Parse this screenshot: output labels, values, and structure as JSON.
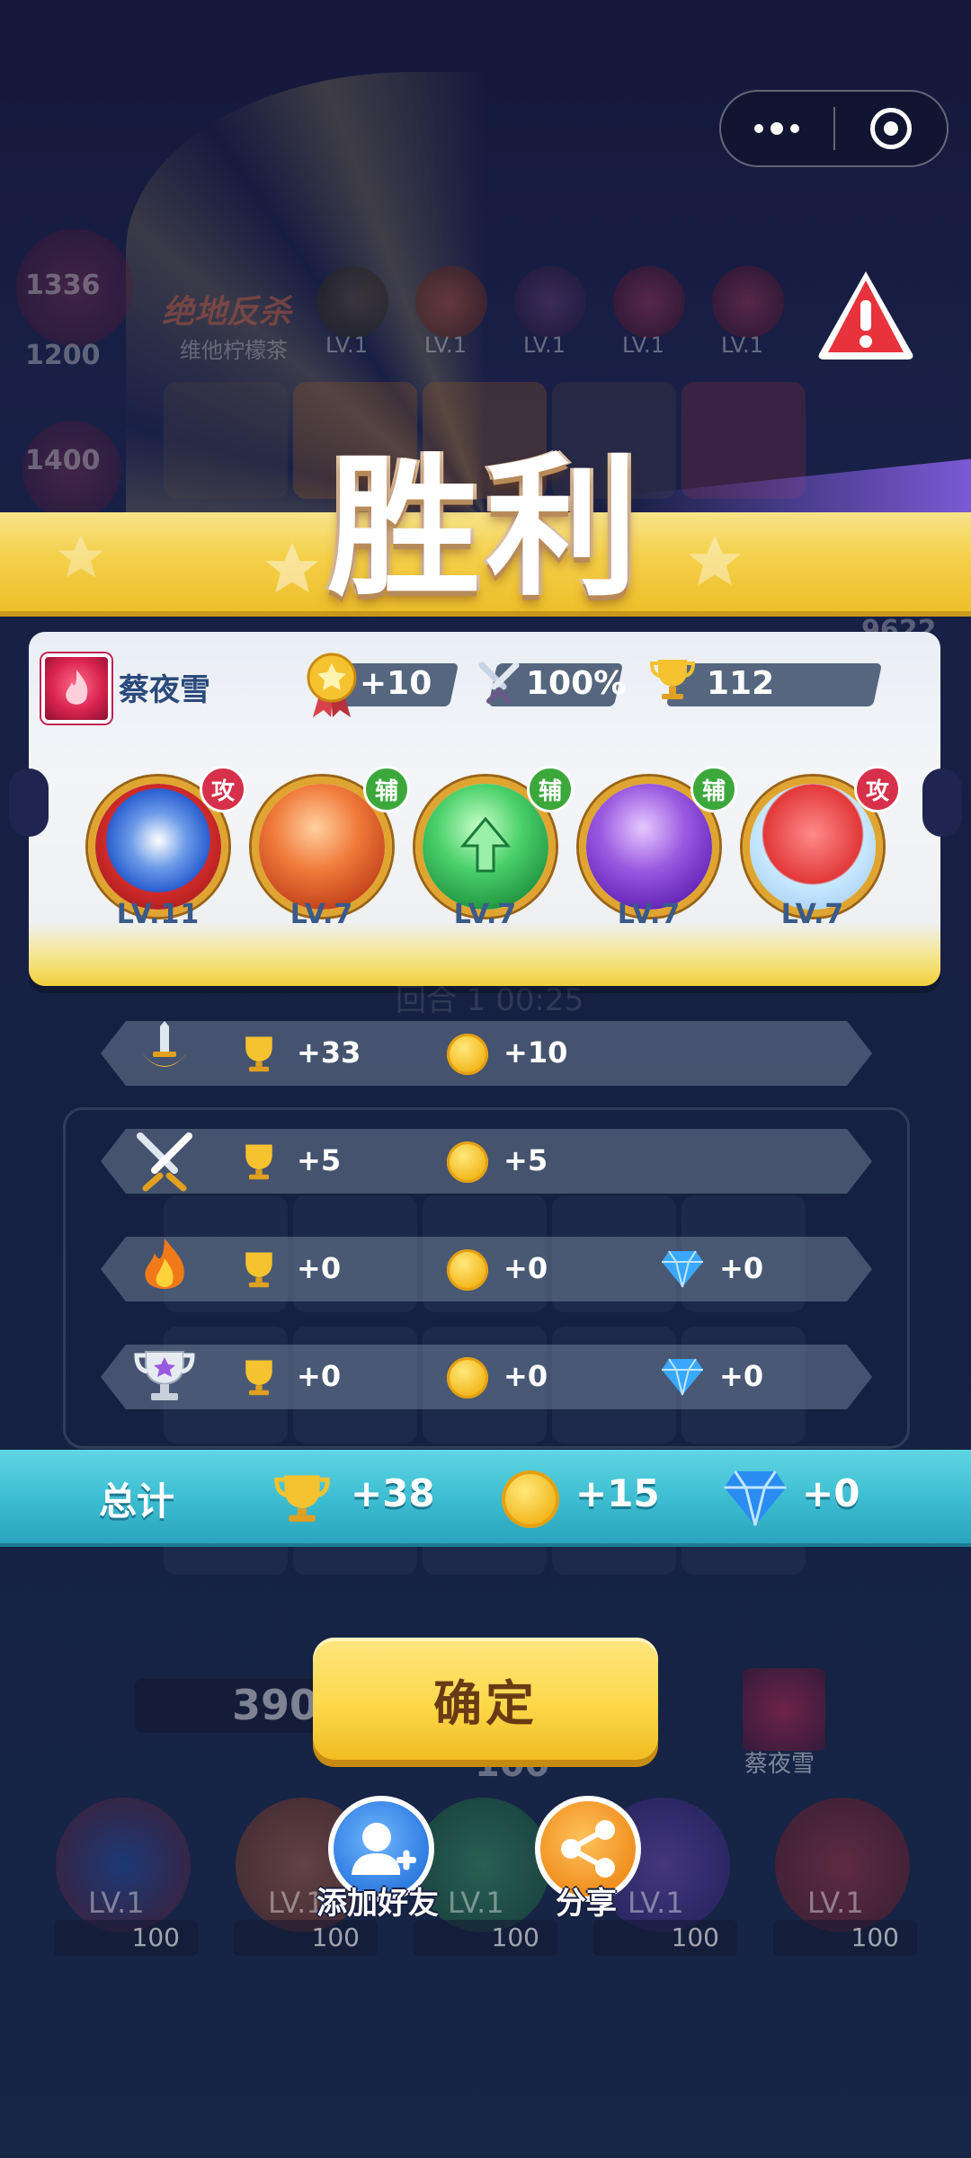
{
  "capsule": {
    "more_icon": "more-dots-icon",
    "close_icon": "target-icon"
  },
  "background": {
    "event_label": "绝地反杀",
    "event_sub": "维他柠檬茶",
    "top_levels": [
      "LV.1",
      "LV.1",
      "LV.1",
      "LV.1",
      "LV.1"
    ],
    "scores": [
      "1336",
      "1200",
      "1400"
    ],
    "right_score": "9622",
    "round_timer": "回合 1 00:25",
    "sp_value": "390",
    "sp_sub": "100",
    "opponent_name": "蔡夜雪",
    "bottom_levels": [
      "LV.1",
      "LV.1",
      "LV.1",
      "LV.1",
      "LV.1"
    ],
    "bottom_sp": [
      "100",
      "100",
      "100",
      "100",
      "100"
    ]
  },
  "victory": {
    "title": "胜利"
  },
  "player": {
    "name": "蔡夜雪",
    "medal_bonus": "+10",
    "win_rate": "100%",
    "trophies": "112"
  },
  "heroes": [
    {
      "level": "LV.11",
      "role": "攻",
      "icon": "opera-mask-icon",
      "color": "#2a5fd0"
    },
    {
      "level": "LV.7",
      "role": "辅",
      "icon": "phoenix-orb-icon",
      "color": "#e0602a"
    },
    {
      "level": "LV.7",
      "role": "辅",
      "icon": "arrow-star-orb-icon",
      "color": "#2fae4a"
    },
    {
      "level": "LV.7",
      "role": "辅",
      "icon": "purple-leaf-orb-icon",
      "color": "#7a3ad0"
    },
    {
      "level": "LV.7",
      "role": "攻",
      "icon": "red-blob-icon",
      "color": "#e23838"
    }
  ],
  "rewards": [
    {
      "icon": "sword-shield-icon",
      "trophy": "+33",
      "coin": "+10"
    },
    {
      "icon": "crossed-swords-icon",
      "trophy": "+5",
      "coin": "+5"
    },
    {
      "icon": "fire-icon",
      "trophy": "+0",
      "coin": "+0",
      "gem": "+0"
    },
    {
      "icon": "silver-cup-icon",
      "trophy": "+0",
      "coin": "+0",
      "gem": "+0"
    }
  ],
  "total": {
    "label": "总计",
    "trophy": "+38",
    "coin": "+15",
    "gem": "+0"
  },
  "actions": {
    "confirm": "确定",
    "add_friend": "添加好友",
    "share": "分享"
  },
  "colors": {
    "banner": "#f4d04a",
    "total_bar": "#3cbcd0",
    "confirm": "#fcd84a",
    "card": "#eef0f2"
  }
}
